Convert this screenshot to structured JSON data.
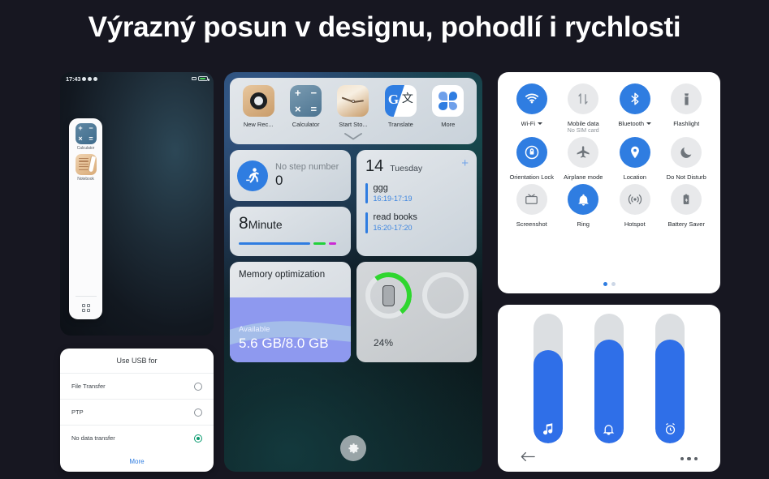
{
  "title": "Výrazný posun v designu, pohodlí i rychlosti",
  "colors": {
    "background": "#171721",
    "accent_blue": "#2f7de1",
    "slider_blue": "#2f6fe8",
    "green": "#2fd62f",
    "radio_green": "#089a6e",
    "magenta": "#cc29d4",
    "memory_purple": "#8e99ef"
  },
  "phone_recents": {
    "status_bar": {
      "time": "17:43"
    },
    "sidebar": {
      "apps": [
        {
          "label": "Calculator",
          "icon": "calculator-icon"
        },
        {
          "label": "Notebook",
          "icon": "notebook-icon"
        }
      ],
      "bottom_button_icon": "app-grid-icon"
    }
  },
  "usb_dialog": {
    "title": "Use USB for",
    "options": [
      {
        "label": "File Transfer",
        "selected": false
      },
      {
        "label": "PTP",
        "selected": false
      },
      {
        "label": "No data transfer",
        "selected": true
      }
    ],
    "more_label": "More"
  },
  "phone_widgets": {
    "apps": [
      {
        "label": "New Rec...",
        "icon": "new-recording-icon"
      },
      {
        "label": "Calculator",
        "icon": "calculator-icon"
      },
      {
        "label": "Start Sto...",
        "icon": "stopwatch-icon"
      },
      {
        "label": "Translate",
        "icon": "translate-icon"
      },
      {
        "label": "More",
        "icon": "more-apps-icon"
      }
    ],
    "collapse_icon": "chevron-down-icon",
    "step_widget": {
      "icon": "running-person-icon",
      "caption": "No step number",
      "value": "0"
    },
    "timer_widget": {
      "number": "8",
      "unit": "Minute"
    },
    "calendar_widget": {
      "day": "14",
      "weekday": "Tuesday",
      "add_icon": "plus-icon",
      "events": [
        {
          "title": "ggg",
          "time": "16:19-17:19"
        },
        {
          "title": "read books",
          "time": "16:20-17:20"
        }
      ]
    },
    "memory_widget": {
      "title": "Memory optimization",
      "caption": "Available",
      "value": "5.6 GB/8.0 GB"
    },
    "battery_widget": {
      "percent": "24%",
      "icon": "phone-battery-icon"
    },
    "settings_button_icon": "gear-icon"
  },
  "quick_settings": {
    "tiles": [
      {
        "label": "Wi-Fi",
        "sub": "",
        "icon": "wifi-icon",
        "on": true,
        "caret": true
      },
      {
        "label": "Mobile data",
        "sub": "No SIM card",
        "icon": "mobile-data-icon",
        "on": false,
        "caret": false
      },
      {
        "label": "Bluetooth",
        "sub": "",
        "icon": "bluetooth-icon",
        "on": true,
        "caret": true
      },
      {
        "label": "Flashlight",
        "sub": "",
        "icon": "flashlight-icon",
        "on": false,
        "caret": false
      },
      {
        "label": "Orientation Lock",
        "sub": "",
        "icon": "orientation-lock-icon",
        "on": true,
        "caret": false
      },
      {
        "label": "Airplane mode",
        "sub": "",
        "icon": "airplane-icon",
        "on": false,
        "caret": false
      },
      {
        "label": "Location",
        "sub": "",
        "icon": "location-pin-icon",
        "on": true,
        "caret": false
      },
      {
        "label": "Do Not Disturb",
        "sub": "",
        "icon": "moon-icon",
        "on": false,
        "caret": false
      },
      {
        "label": "Screenshot",
        "sub": "",
        "icon": "screenshot-icon",
        "on": false,
        "caret": false
      },
      {
        "label": "Ring",
        "sub": "",
        "icon": "bell-icon",
        "on": true,
        "caret": false
      },
      {
        "label": "Hotspot",
        "sub": "",
        "icon": "hotspot-icon",
        "on": false,
        "caret": false
      },
      {
        "label": "Battery Saver",
        "sub": "",
        "icon": "battery-saver-icon",
        "on": false,
        "caret": false
      }
    ],
    "page_dots": {
      "count": 2,
      "active_index": 0
    }
  },
  "volume_panel": {
    "sliders": [
      {
        "name": "media",
        "icon": "music-note-icon",
        "level_percent": 72
      },
      {
        "name": "ring",
        "icon": "bell-icon",
        "level_percent": 80
      },
      {
        "name": "alarm",
        "icon": "alarm-clock-icon",
        "level_percent": 80
      }
    ],
    "back_icon": "back-arrow-icon",
    "more_icon": "more-dots-icon"
  }
}
